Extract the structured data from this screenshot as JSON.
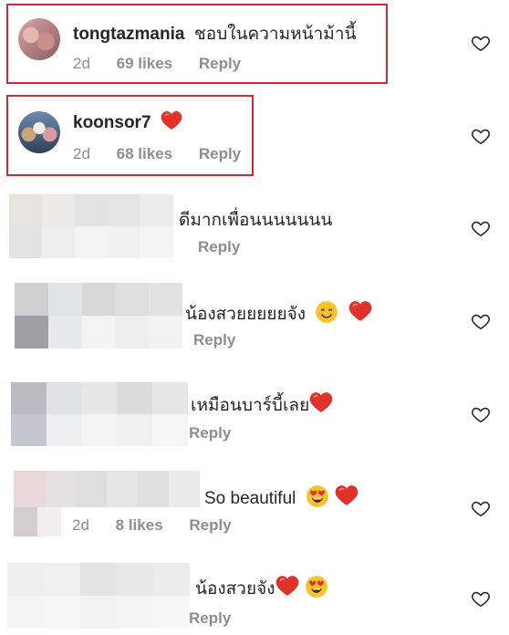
{
  "comments": [
    {
      "username": "tongtazmania",
      "text": "ชอบในความหน้าม้านี้",
      "time": "2d",
      "likes": "69 likes",
      "reply": "Reply"
    },
    {
      "username": "koonsor7",
      "text": "",
      "time": "2d",
      "likes": "68 likes",
      "reply": "Reply"
    },
    {
      "username": "",
      "text": "ดีมากเพื่อนนนนนนน",
      "reply": "Reply"
    },
    {
      "username": "",
      "text": "น้องสวยยยยยจัง",
      "reply": "Reply"
    },
    {
      "username": "",
      "text": "เหมือนบาร์บี้เลย",
      "reply": "Reply"
    },
    {
      "username": "",
      "text": "So beautiful",
      "time": "2d",
      "likes": "8 likes",
      "reply": "Reply"
    },
    {
      "username": "",
      "text": "น้องสวยจัง",
      "reply": "Reply"
    }
  ],
  "icons": {
    "like": "heart-outline-icon",
    "red_heart": "red-heart-emoji",
    "smile": "smiling-face-emoji",
    "heart_eyes": "heart-eyes-emoji"
  },
  "colors": {
    "highlight_box": "#cc2a35",
    "meta_text": "#8e8e8e",
    "heart_emoji": "#e0322b"
  }
}
